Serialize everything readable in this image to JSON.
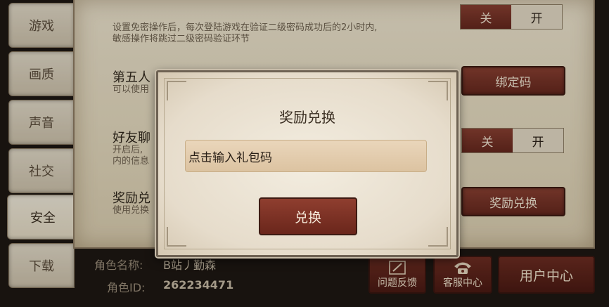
{
  "tabs": [
    "游戏",
    "画质",
    "声音",
    "社交",
    "安全",
    "下载"
  ],
  "rows": {
    "top_desc_line1": "设置免密操作后，每次登陆游戏在验证二级密码成功后的2小时内,",
    "top_desc_line2": "敏感操作将跳过二级密码验证环节",
    "top_toggle_off": "关",
    "top_toggle_on": "开",
    "row2_title": "第五人",
    "row2_desc": "可以使用",
    "row2_button": "绑定码",
    "row3_title": "好友聊",
    "row3_desc_line1": "开启后,",
    "row3_desc_line2": "内的信息",
    "row3_toggle_off": "关",
    "row3_toggle_on": "开",
    "row4_title": "奖励兑",
    "row4_desc": "使用兑换",
    "row4_button": "奖励兑换"
  },
  "footer": {
    "role_name_label": "角色名称:",
    "role_name_value": "B站丿勤森",
    "role_id_label": "角色ID:",
    "role_id_value": "262234471",
    "feedback_label": "问题反馈",
    "service_label": "客服中心",
    "user_center_label": "用户中心"
  },
  "dialog": {
    "title": "奖励兑换",
    "input_placeholder": "点击输入礼包码",
    "confirm_label": "兑换"
  },
  "colors": {
    "accent_red": "#7a3528",
    "parchment": "#e8dec6"
  }
}
